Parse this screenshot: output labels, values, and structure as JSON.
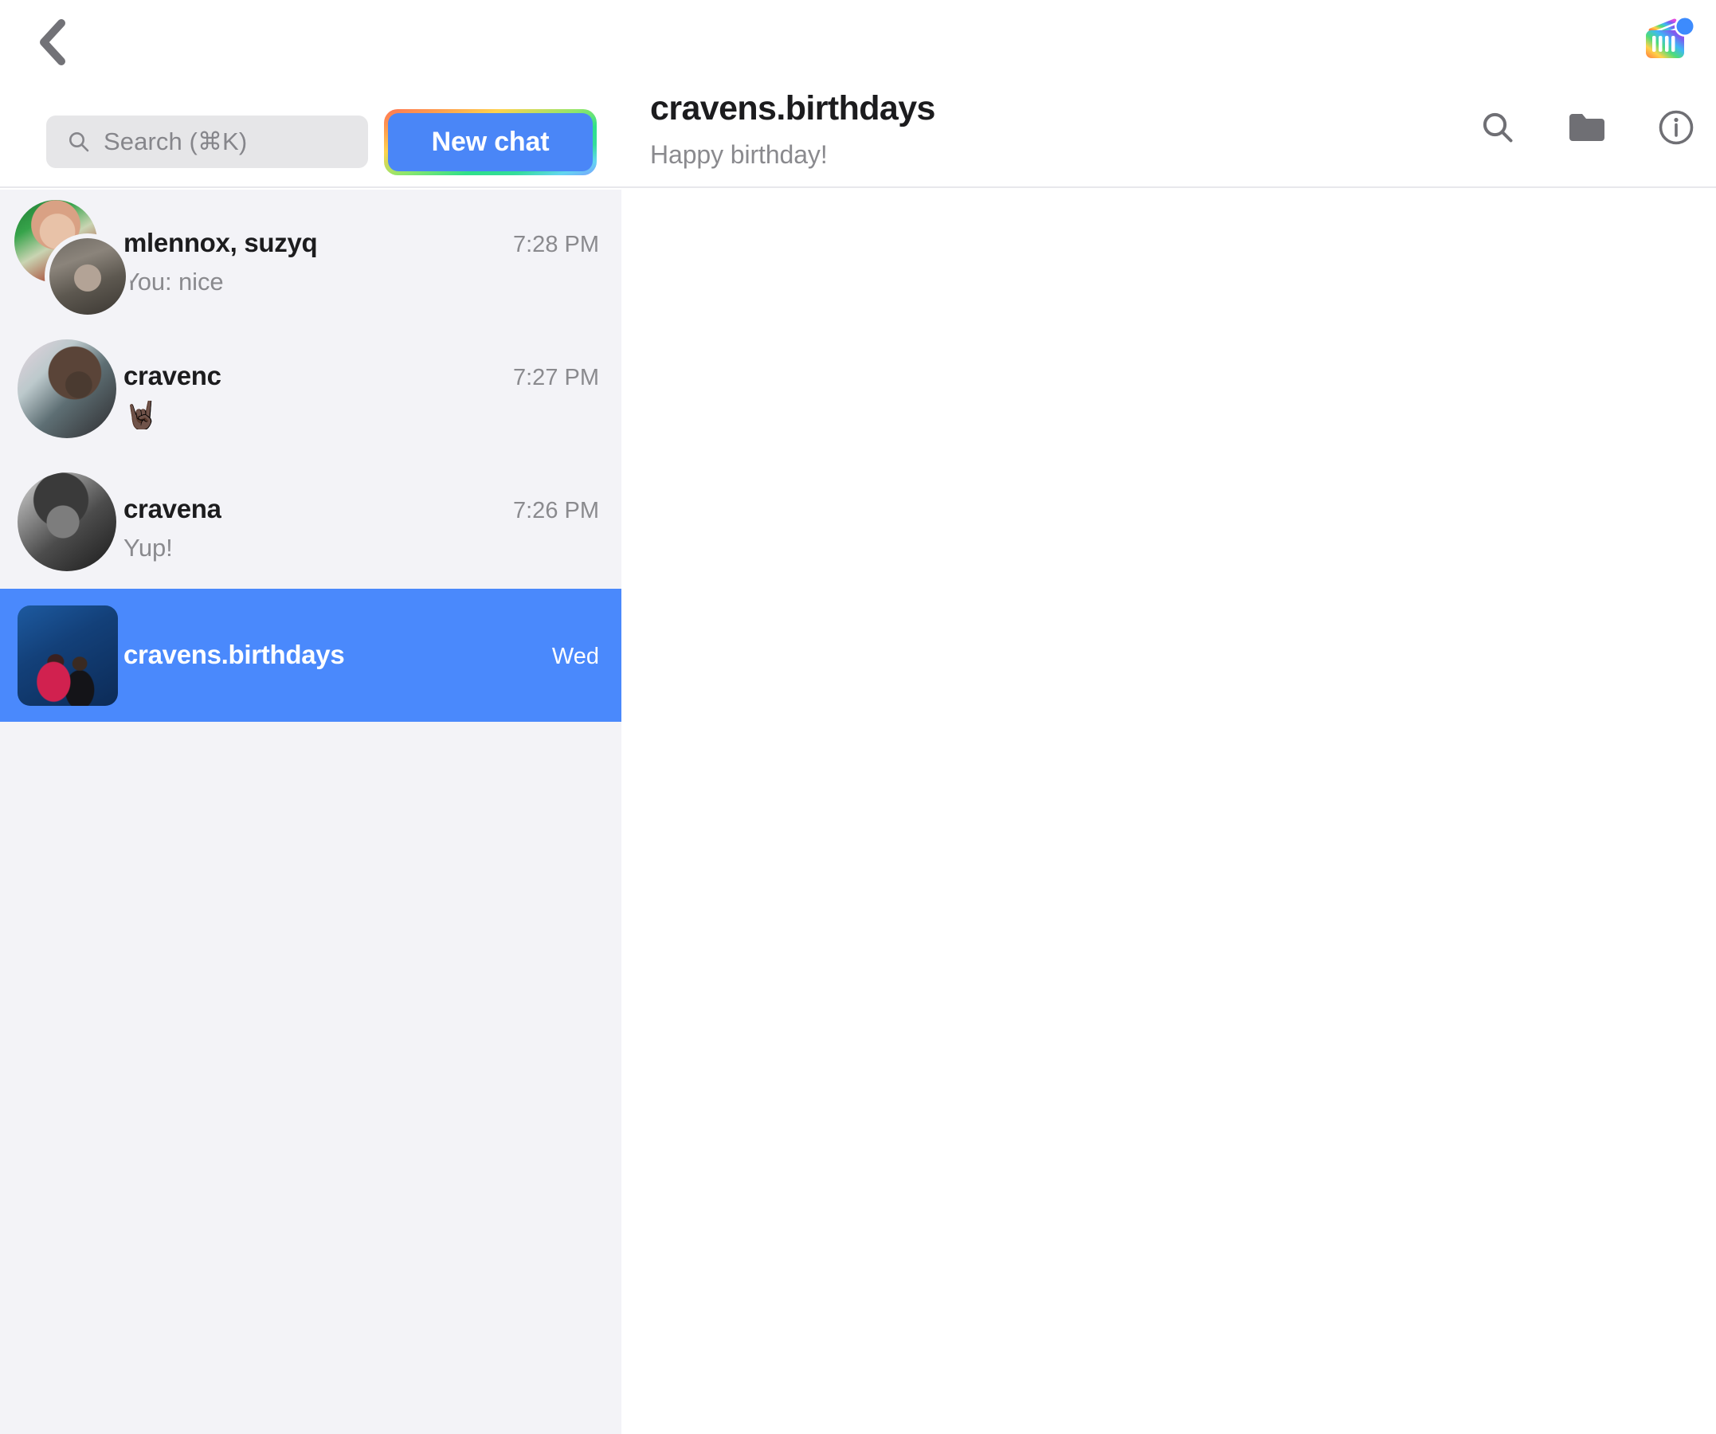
{
  "topbar": {
    "back_icon": "chevron-left-icon",
    "app_icon": "rainbow-app-icon",
    "app_icon_badge": "blue-dot",
    "search": {
      "placeholder": "Search (⌘K)",
      "icon": "search-icon"
    },
    "new_chat_label": "New chat",
    "new_chat_focused": true
  },
  "header": {
    "title": "cravens.birthdays",
    "subtitle": "Happy birthday!",
    "actions": [
      {
        "name": "search-icon",
        "label": "Search"
      },
      {
        "name": "folder-icon",
        "label": "Folder"
      },
      {
        "name": "info-icon",
        "label": "Details"
      }
    ]
  },
  "sidebar": {
    "chats": [
      {
        "name": "mlennox, suzyq",
        "time": "7:28 PM",
        "preview": "You: nice",
        "preview_is_emoji": false,
        "avatar_type": "group",
        "selected": false
      },
      {
        "name": "cravenc",
        "time": "7:27 PM",
        "preview": "🤘🏿",
        "preview_is_emoji": true,
        "avatar_type": "single",
        "selected": false
      },
      {
        "name": "cravena",
        "time": "7:26 PM",
        "preview": "Yup!",
        "preview_is_emoji": false,
        "avatar_type": "single",
        "selected": false
      },
      {
        "name": "cravens.birthdays",
        "time": "Wed",
        "preview": "",
        "preview_is_emoji": false,
        "avatar_type": "square",
        "selected": true
      }
    ]
  },
  "colors": {
    "accent_blue": "#4a86f7",
    "selected_row_blue": "#4a89fc",
    "sidebar_bg": "#f3f3f7",
    "main_bg": "#ffffff",
    "primary_text": "#1c1c1e",
    "secondary_text": "#8a8a8e",
    "search_field_bg": "#e6e6e8",
    "divider": "#e8e8ec"
  }
}
